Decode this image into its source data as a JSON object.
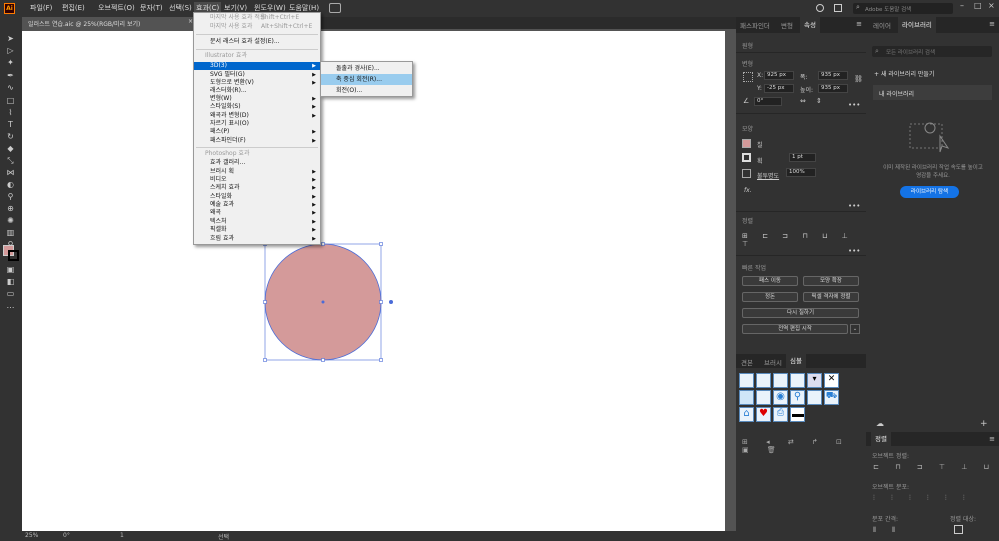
{
  "app": {
    "logo": "Ai"
  },
  "menubar": {
    "items": [
      "파일(F)",
      "편집(E)",
      "오브젝트(O)",
      "문자(T)",
      "선택(S)",
      "효과(C)",
      "보기(V)",
      "윈도우(W)",
      "도움말(H)"
    ],
    "search_placeholder": "Adobe 도움말 검색"
  },
  "document": {
    "tab_title": "일러스트 연습.aic @ 25%(RGB/미리 보기)",
    "close": "×"
  },
  "effect_menu": {
    "items": [
      {
        "label": "마지막 사용 효과 적용",
        "shortcut": "Shift+Ctrl+E",
        "disabled": true
      },
      {
        "label": "마지막 사용 효과",
        "shortcut": "Alt+Shift+Ctrl+E",
        "disabled": true
      },
      {
        "label": "문서 래스터 효과 설정(E)..."
      },
      {
        "label": "Illustrator 효과",
        "header": true
      },
      {
        "label": "3D(3)",
        "submenu": true,
        "highlighted": true
      },
      {
        "label": "SVG 필터(G)",
        "submenu": true
      },
      {
        "label": "도형으로 변환(V)",
        "submenu": true
      },
      {
        "label": "래스터화(R)..."
      },
      {
        "label": "변형(W)",
        "submenu": true
      },
      {
        "label": "스타일화(S)",
        "submenu": true
      },
      {
        "label": "왜곡과 변형(D)",
        "submenu": true
      },
      {
        "label": "자르기 표시(O)"
      },
      {
        "label": "패스(P)",
        "submenu": true
      },
      {
        "label": "패스파인더(F)",
        "submenu": true
      },
      {
        "label": "Photoshop 효과",
        "header": true
      },
      {
        "label": "효과 갤러리..."
      },
      {
        "label": "브러시 획",
        "submenu": true
      },
      {
        "label": "비디오",
        "submenu": true
      },
      {
        "label": "스케치 효과",
        "submenu": true
      },
      {
        "label": "스타일화",
        "submenu": true
      },
      {
        "label": "예술 효과",
        "submenu": true
      },
      {
        "label": "왜곡",
        "submenu": true
      },
      {
        "label": "텍스처",
        "submenu": true
      },
      {
        "label": "픽셀화",
        "submenu": true
      },
      {
        "label": "흐림 효과",
        "submenu": true
      }
    ]
  },
  "submenu_3d": {
    "items": [
      "돌출과 경사(E)...",
      "축 중심 회전(R)...",
      "회전(O)..."
    ],
    "highlighted": 1
  },
  "panel_tabs": [
    "패스파인더",
    "변형",
    "속성"
  ],
  "properties": {
    "section_shape": "원형",
    "section_transform": "변형",
    "x_label": "X:",
    "x_value": "925 px",
    "y_label": "Y:",
    "y_value": "-25 px",
    "w_label": "폭:",
    "w_value": "935 px",
    "h_label": "높이:",
    "h_value": "935 px",
    "angle_value": "0°",
    "section_appearance": "모양",
    "fill_label": "칠",
    "stroke_label": "획",
    "stroke_weight": "1 pt",
    "opacity_label": "불투명도",
    "opacity_value": "100%",
    "fx_label": "fx.",
    "section_align": "정렬",
    "section_quick": "빠른 작업",
    "btn_offset": "패스 이동",
    "btn_expand": "모양 확장",
    "btn_group": "정돈",
    "btn_recolor": "픽셀 격자에 정렬",
    "btn_recolor2": "다시 칠하기",
    "btn_global_edit": "전역 편집 시작"
  },
  "symbols_tabs": [
    "견본",
    "브러시",
    "심볼"
  ],
  "far_tabs": [
    "레이어",
    "라이브러리"
  ],
  "library": {
    "search_placeholder": "모든 라이브러리 검색",
    "new_library": "새 라이브러리 만들기",
    "my_library": "내 라이브러리",
    "empty_text": "이미 제작된 라이브러리 작업 속도를 높이고 영감을 주세요.",
    "browse_btn": "라이브러리 탐색"
  },
  "align_panel": {
    "title": "정렬",
    "obj_align": "오브젝트 정렬:",
    "obj_distribute": "오브젝트 분포:",
    "dist_spacing": "분포 간격:",
    "align_to": "정렬 대상:"
  },
  "status": {
    "zoom": "25%",
    "angle": "0°",
    "page": "1",
    "tool": "선택"
  },
  "colors": {
    "circle_fill": "#d49a9a",
    "selection": "#4a6bd8",
    "accent": "#1473e6"
  }
}
